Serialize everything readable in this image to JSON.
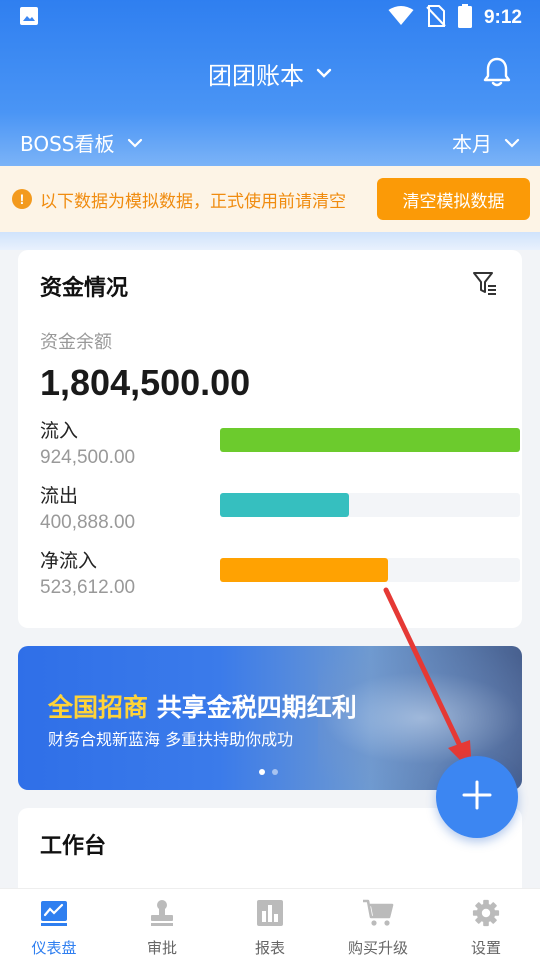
{
  "status_bar": {
    "time": "9:12"
  },
  "header": {
    "title": "团团账本"
  },
  "subheader": {
    "board": "BOSS看板",
    "period": "本月"
  },
  "notice": {
    "text": "以下数据为模拟数据，正式使用前请清空",
    "button_label": "清空模拟数据",
    "icon": "!"
  },
  "funds": {
    "title": "资金情况",
    "balance_label": "资金余额",
    "balance_value": "1,804,500.00",
    "rows": [
      {
        "label": "流入",
        "amount": "924,500.00",
        "ratio": 1.0,
        "color": "#6ccb2d"
      },
      {
        "label": "流出",
        "amount": "400,888.00",
        "ratio": 0.43,
        "color": "#36bfbf"
      },
      {
        "label": "净流入",
        "amount": "523,612.00",
        "ratio": 0.56,
        "color": "#ffa202"
      }
    ]
  },
  "banner": {
    "title_highlight": "全国招商",
    "title_rest": "共享金税四期红利",
    "subtitle": "财务合规新蓝海 多重扶持助你成功",
    "slide_count": 2,
    "active_slide": 1
  },
  "workbench": {
    "title": "工作台"
  },
  "tabbar": {
    "items": [
      {
        "label": "仪表盘",
        "icon": "dashboard-icon",
        "active": true
      },
      {
        "label": "审批",
        "icon": "stamp-icon",
        "active": false
      },
      {
        "label": "报表",
        "icon": "report-icon",
        "active": false
      },
      {
        "label": "购买升级",
        "icon": "cart-icon",
        "active": false
      },
      {
        "label": "设置",
        "icon": "gear-icon",
        "active": false
      }
    ]
  },
  "colors": {
    "primary": "#2f7ff0",
    "warning": "#fb9a07",
    "arrow": "#e53935"
  }
}
